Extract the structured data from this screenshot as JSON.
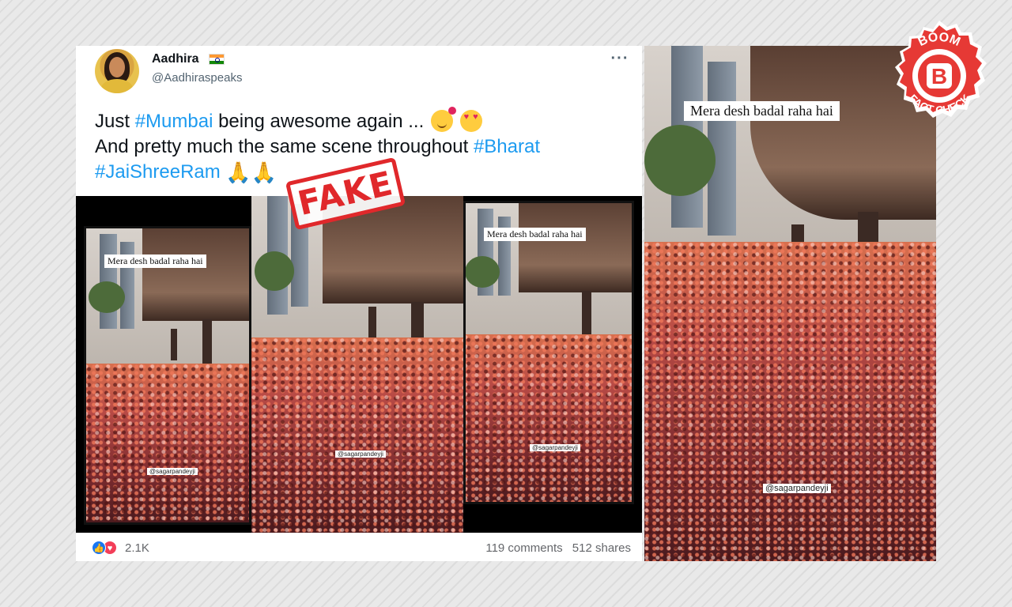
{
  "post": {
    "display_name": "Aadhira",
    "handle": "@Aadhiraspeaks",
    "text": {
      "line1_prefix": "Just ",
      "line1_tag": "#Mumbai",
      "line1_suffix": " being awesome again ...",
      "line2_prefix": "And pretty much the same scene throughout ",
      "line2_tag": "#Bharat",
      "line3_tag": "#JaiShreeRam"
    },
    "fake_stamp": "FAKE",
    "reactions_count": "2.1K",
    "comments": "119 comments",
    "shares": "512 shares"
  },
  "media": {
    "caption": "Mera desh badal raha hai",
    "watermark": "@sagarpandeyji"
  },
  "badge": {
    "top_text": "BOOM",
    "letter": "B",
    "bottom_text": "FACT CHECK"
  },
  "colors": {
    "hashtag": "#1d9bf0",
    "fake_red": "#e0282b",
    "boom_red": "#e63935"
  },
  "icons": [
    "flag-india-icon",
    "more-options-icon",
    "smiling-hearts-emoji",
    "heart-eyes-emoji",
    "folded-hands-emoji",
    "like-reaction-icon",
    "love-reaction-icon",
    "boom-logo"
  ]
}
